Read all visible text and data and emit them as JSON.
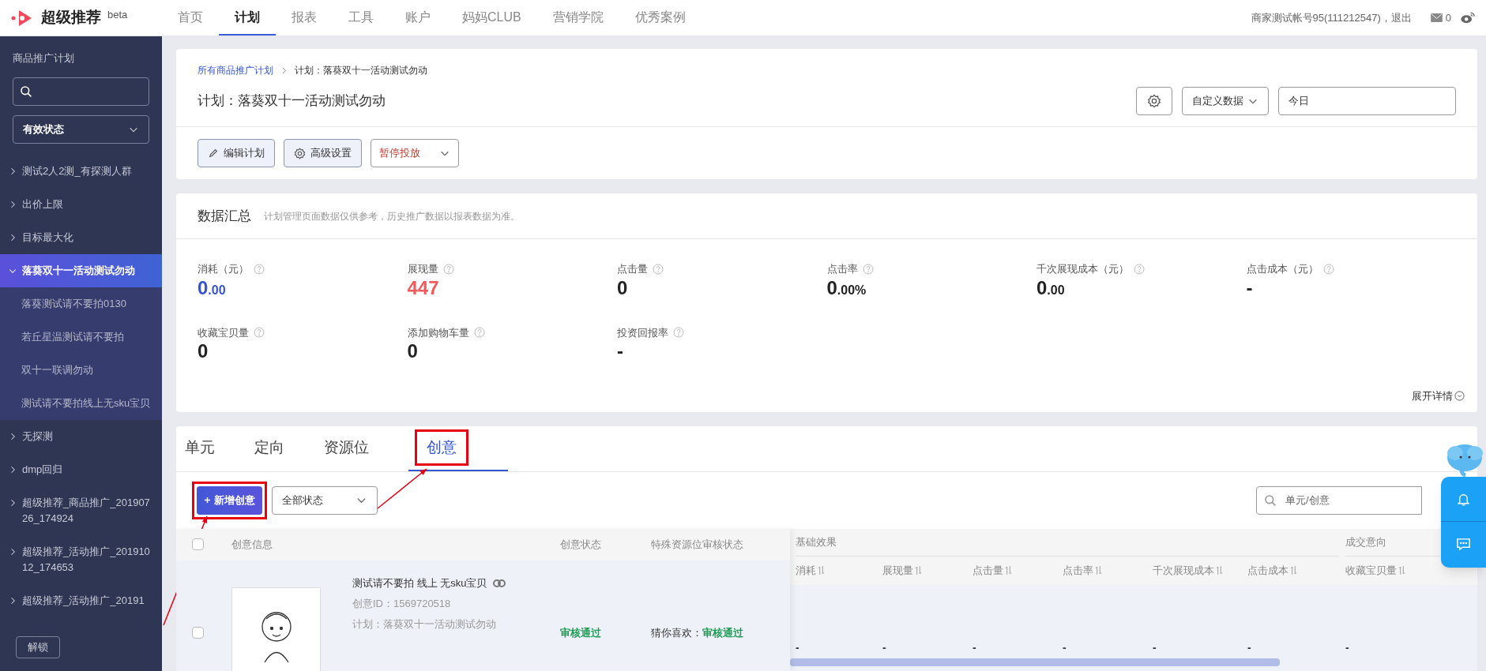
{
  "brand": {
    "name": "超级推荐",
    "tag": "beta"
  },
  "nav": [
    {
      "label": "首页",
      "selected": false
    },
    {
      "label": "计划",
      "selected": true
    },
    {
      "label": "报表",
      "selected": false
    },
    {
      "label": "工具",
      "selected": false
    },
    {
      "label": "账户",
      "selected": false
    },
    {
      "label": "妈妈CLUB",
      "selected": false
    },
    {
      "label": "营销学院",
      "selected": false
    },
    {
      "label": "优秀案例",
      "selected": false
    }
  ],
  "account": {
    "user": "商家测试帐号95(111212547)，退出",
    "mail_count": "0"
  },
  "sidebar": {
    "title": "商品推广计划",
    "status_filter": "有效状态",
    "items": [
      {
        "label": "测试2人2测_有探测人群",
        "expanded": false,
        "selected": false
      },
      {
        "label": "出价上限",
        "expanded": false,
        "selected": false
      },
      {
        "label": "目标最大化",
        "expanded": false,
        "selected": false
      },
      {
        "label": "落葵双十一活动测试勿动",
        "expanded": true,
        "selected": true,
        "children": [
          {
            "label": "落葵测试请不要拍0130"
          },
          {
            "label": "若丘星温测试请不要拍"
          },
          {
            "label": "双十一联调勿动"
          },
          {
            "label": "测试请不要拍线上无sku宝贝"
          }
        ]
      },
      {
        "label": "无探测",
        "expanded": false,
        "selected": false
      },
      {
        "label": "dmp回归",
        "expanded": false,
        "selected": false
      },
      {
        "label": "超级推荐_商品推广_20190726_174924",
        "expanded": false,
        "selected": false
      },
      {
        "label": "超级推荐_活动推广_20191012_174653",
        "expanded": false,
        "selected": false
      },
      {
        "label": "超级推荐_活动推广_20191",
        "expanded": false,
        "selected": false
      }
    ],
    "unlock_button": "解锁"
  },
  "plan": {
    "breadcrumb": [
      "所有商品推广计划",
      "计划：落葵双十一活动测试勿动"
    ],
    "title": "计划：落葵双十一活动测试勿动",
    "data_select": "自定义数据",
    "date": "今日",
    "buttons": [
      {
        "label": "编辑计划",
        "kind": "edit"
      },
      {
        "label": "高级设置",
        "kind": "settings"
      }
    ],
    "status_select": "暂停投放"
  },
  "summary": {
    "title": "数据汇总",
    "note": "计划管理页面数据仅供参考，历史推广数据以报表数据为准。",
    "expand": "展开详情",
    "metrics": [
      {
        "label": "消耗（元）",
        "value": "0",
        "fraction": ".00",
        "color": "#3454d1"
      },
      {
        "label": "展现量",
        "value": "447",
        "color": "#f15b5b"
      },
      {
        "label": "点击量",
        "value": "0",
        "color": "#222222"
      },
      {
        "label": "点击率",
        "value": "0",
        "fraction": ".00%",
        "color": "#222222"
      },
      {
        "label": "千次展现成本（元）",
        "value": "0",
        "fraction": ".00",
        "color": "#222222"
      },
      {
        "label": "点击成本（元）",
        "value": "-",
        "color": "#222222"
      },
      {
        "label": "收藏宝贝量",
        "value": "0",
        "color": "#222222"
      },
      {
        "label": "添加购物车量",
        "value": "0",
        "color": "#222222"
      },
      {
        "label": "投资回报率",
        "value": "-",
        "color": "#222222"
      }
    ]
  },
  "tabs": [
    {
      "label": "单元",
      "selected": false
    },
    {
      "label": "定向",
      "selected": false
    },
    {
      "label": "资源位",
      "selected": false
    },
    {
      "label": "创意",
      "selected": true
    }
  ],
  "toolbar": {
    "add_button": "新增创意",
    "status_filter": "全部状态",
    "search": {
      "placeholder": "单元/创意"
    }
  },
  "table": {
    "all_checked": false,
    "columns": [
      "创意信息",
      "创意状态",
      "特殊资源位审核状态"
    ],
    "groups": [
      {
        "label": "基础效果",
        "columns": [
          "消耗",
          "展现量",
          "点击量",
          "点击率",
          "千次展现成本",
          "点击成本"
        ]
      },
      {
        "label": "成交意向",
        "columns": [
          "收藏宝贝量"
        ]
      }
    ],
    "rows": [
      {
        "checked": false,
        "title": "测试请不要拍 线上 无sku宝贝",
        "id": "创意ID：1569720518",
        "plan": "计划：落葵双十一活动测试勿动",
        "status": "审核通过",
        "special_label": "猜你喜欢：",
        "special_status": "审核通过",
        "metrics": [
          "-",
          "-",
          "-",
          "-",
          "-",
          "-",
          "-"
        ]
      }
    ]
  }
}
